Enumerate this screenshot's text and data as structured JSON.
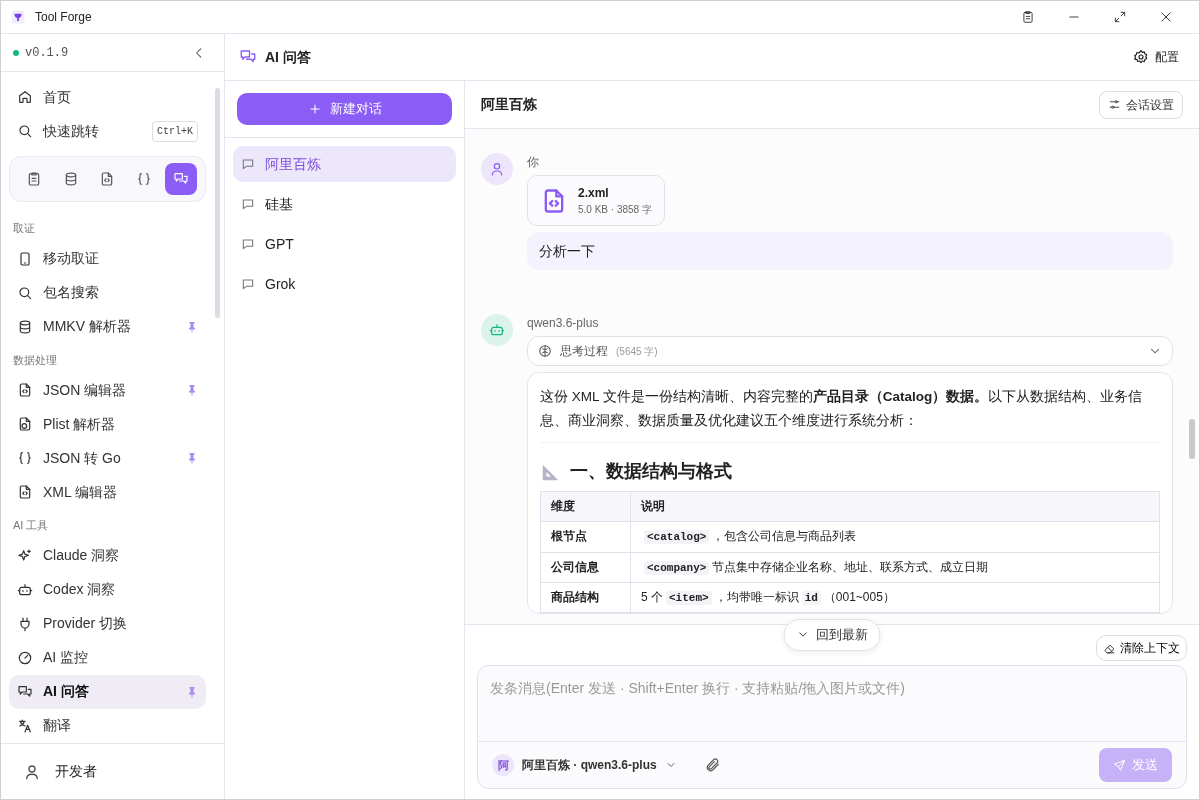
{
  "window": {
    "title": "Tool Forge"
  },
  "sidebar": {
    "version": "v0.1.9",
    "online": true,
    "nav": [
      {
        "label": "首页",
        "selected": false
      },
      {
        "label": "快速跳转",
        "shortcut": "Ctrl+K",
        "selected": false
      }
    ],
    "quick_tools": [
      {
        "selected": false
      },
      {
        "selected": false
      },
      {
        "selected": false
      },
      {
        "selected": false
      },
      {
        "selected": true
      }
    ],
    "sections": [
      {
        "title": "取证",
        "items": [
          {
            "label": "移动取证",
            "pinned": false,
            "selected": false
          },
          {
            "label": "包名搜索",
            "pinned": false,
            "selected": false
          },
          {
            "label": "MMKV 解析器",
            "pinned": true,
            "selected": false
          }
        ]
      },
      {
        "title": "数据处理",
        "items": [
          {
            "label": "JSON 编辑器",
            "pinned": true,
            "selected": false
          },
          {
            "label": "Plist 解析器",
            "pinned": false,
            "selected": false
          },
          {
            "label": "JSON 转 Go",
            "pinned": true,
            "selected": false
          },
          {
            "label": "XML 编辑器",
            "pinned": false,
            "selected": false
          }
        ]
      },
      {
        "title": "AI 工具",
        "items": [
          {
            "label": "Claude 洞察",
            "pinned": false,
            "selected": false
          },
          {
            "label": "Codex 洞察",
            "pinned": false,
            "selected": false
          },
          {
            "label": "Provider 切换",
            "pinned": false,
            "selected": false
          },
          {
            "label": "AI 监控",
            "pinned": false,
            "selected": false
          },
          {
            "label": "AI 问答",
            "pinned": true,
            "selected": true
          },
          {
            "label": "翻译",
            "pinned": false,
            "selected": false
          }
        ]
      }
    ],
    "user": "开发者"
  },
  "page": {
    "title": "AI 问答",
    "settings_button": "配置"
  },
  "conversations": {
    "new_button": "新建对话",
    "items": [
      {
        "label": "阿里百炼",
        "selected": true
      },
      {
        "label": "硅基",
        "selected": false
      },
      {
        "label": "GPT",
        "selected": false
      },
      {
        "label": "Grok",
        "selected": false
      }
    ]
  },
  "chat": {
    "title": "阿里百炼",
    "settings_button": "会话设置",
    "user_message": {
      "author": "你",
      "attachment": {
        "name": "2.xml",
        "meta": "5.0 KB · 3858 字"
      },
      "text": "分析一下"
    },
    "assistant_message": {
      "author": "qwen3.6-plus",
      "thinking": {
        "label": "思考过程",
        "count": "(5645 字)",
        "expanded": false
      },
      "intro": "这份 XML 文件是一份结构清晰、内容完整的**产品目录（Catalog）数据。**以下从数据结构、业务信息、商业洞察、数据质量及优化建议五个维度进行系统分析：",
      "heading": "一、数据结构与格式",
      "table": {
        "columns": [
          "维度",
          "说明"
        ],
        "rows": [
          {
            "label": "根节点",
            "parts": [
              {
                "kind": "code",
                "text": "<catalog>"
              },
              {
                "kind": "text",
                "text": "，包含公司信息与商品列表"
              }
            ]
          },
          {
            "label": "公司信息",
            "parts": [
              {
                "kind": "code",
                "text": "<company>"
              },
              {
                "kind": "text",
                "text": "节点集中存储企业名称、地址、联系方式、成立日期"
              }
            ]
          },
          {
            "label": "商品结构",
            "parts": [
              {
                "kind": "text",
                "text": "5 个"
              },
              {
                "kind": "code",
                "text": "<item>"
              },
              {
                "kind": "text",
                "text": "，均带唯一标识"
              },
              {
                "kind": "code",
                "text": "id"
              },
              {
                "kind": "text",
                "text": "（001~005）"
              }
            ]
          }
        ]
      }
    },
    "scroll_button": "回到最新",
    "clear_button": "清除上下文"
  },
  "composer": {
    "placeholder": "发条消息(Enter 发送 · Shift+Enter 换行 · 支持粘贴/拖入图片或文件)",
    "model_badge": "阿",
    "model": "阿里百炼 · qwen3.6-plus",
    "send_button": "发送",
    "send_disabled": true
  }
}
